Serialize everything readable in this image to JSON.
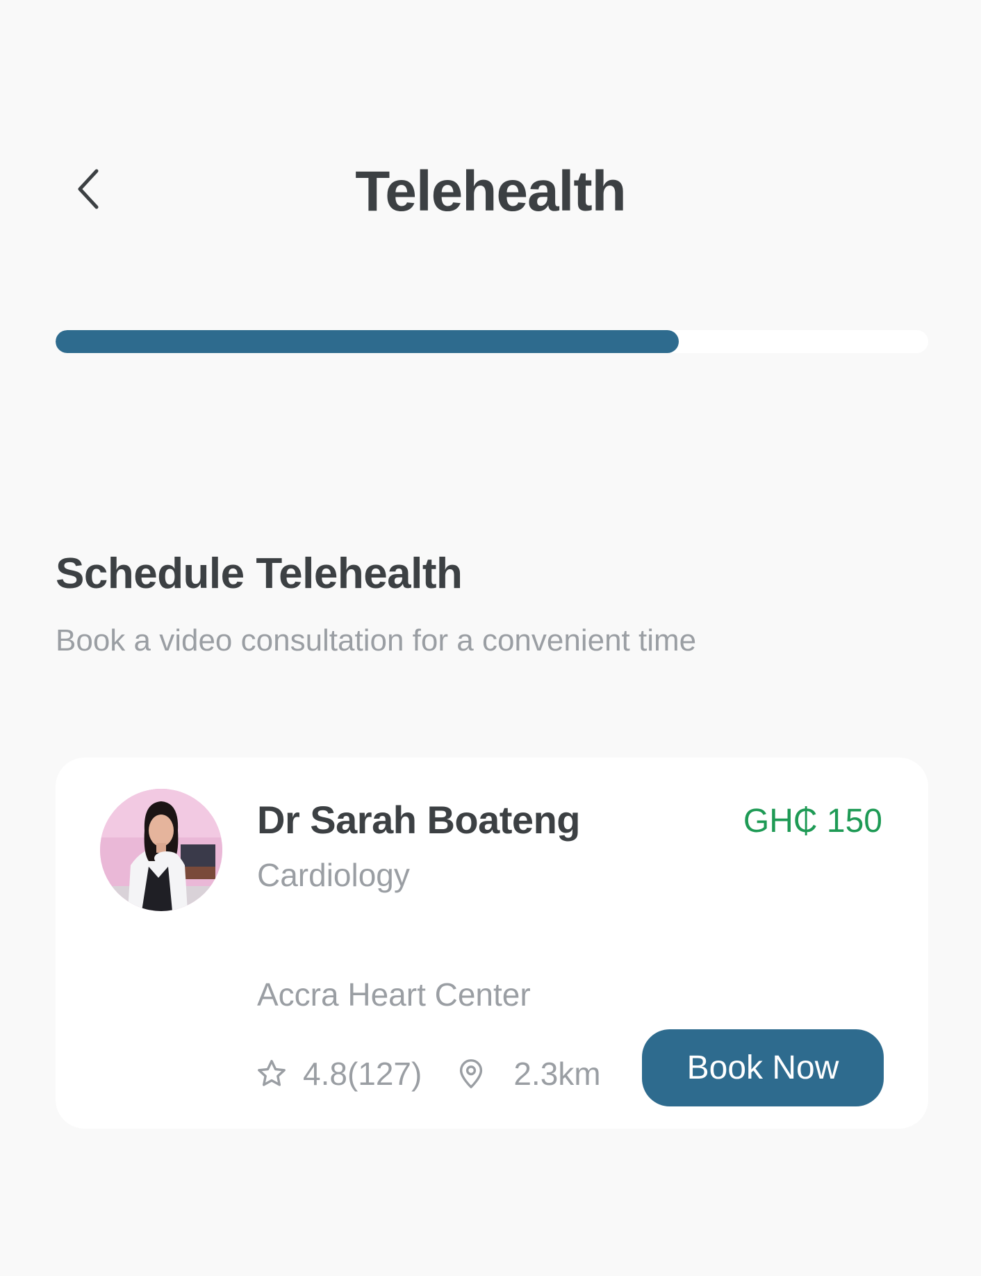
{
  "header": {
    "title": "Telehealth",
    "back_icon": "chevron-left-icon"
  },
  "progress": {
    "fraction": 0.714,
    "fill_color": "#2e6b8e",
    "track_color": "#ffffff"
  },
  "section": {
    "title": "Schedule Telehealth",
    "subtitle": "Book a video consultation for a convenient time"
  },
  "doctor": {
    "name": "Dr Sarah Boateng",
    "specialty": "Cardiology",
    "price": "GH₵ 150",
    "clinic": "Accra Heart Center",
    "rating": "4.8(127)",
    "distance": "2.3km",
    "rating_icon": "star-icon",
    "distance_icon": "location-pin-icon",
    "book_label": "Book Now"
  },
  "colors": {
    "accent": "#2e6b8e",
    "price": "#1e9a55",
    "text_primary": "#3c4043",
    "text_secondary": "#9a9ea3",
    "background": "#f9f9f9"
  }
}
